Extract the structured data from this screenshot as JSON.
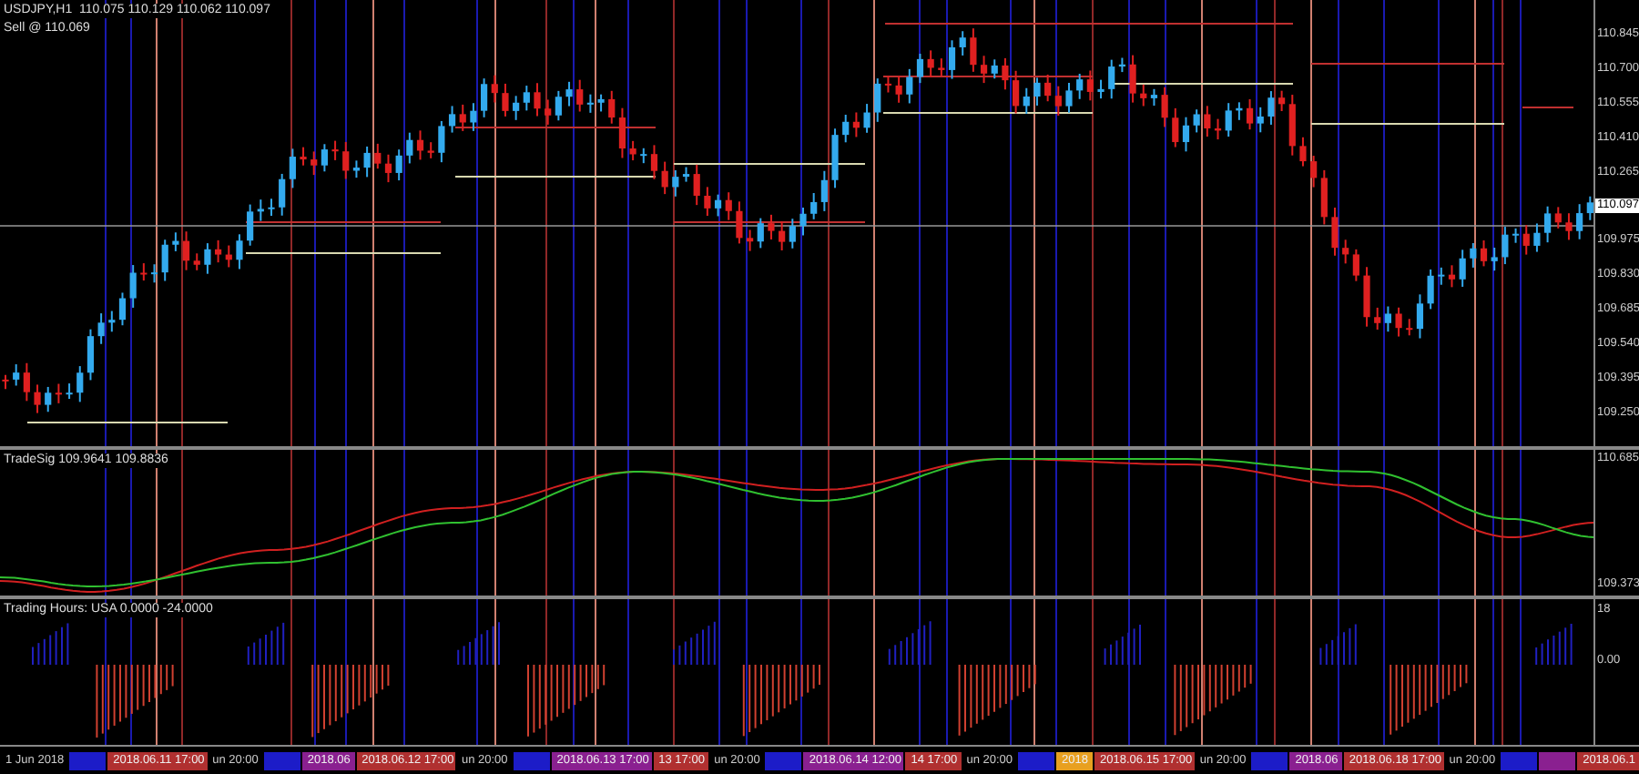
{
  "main_chart": {
    "title": "USDJPY,H1  110.075 110.129 110.062 110.097",
    "order_label": "Sell @ 110.069",
    "price_axis": [
      "110.845",
      "110.700",
      "110.555",
      "110.410",
      "110.265",
      "109.975",
      "109.830",
      "109.685",
      "109.540",
      "109.395",
      "109.250"
    ],
    "current_price": "110.097"
  },
  "trade_sig": {
    "title": "TradeSig 109.9641 109.8836",
    "axis": [
      "110.685",
      "109.373"
    ]
  },
  "trading_hours": {
    "title": "Trading Hours: USA 0.0000 -24.0000",
    "axis": [
      "18",
      "0.00"
    ]
  },
  "time_axis": [
    {
      "kind": "label",
      "text": "1 Jun 2018"
    },
    {
      "kind": "tag",
      "color": "#1c1cc8"
    },
    {
      "kind": "tag",
      "color": "#b03030",
      "text": "2018.06.11 17:00"
    },
    {
      "kind": "label",
      "text": "un 20:00"
    },
    {
      "kind": "tag",
      "color": "#1c1cc8"
    },
    {
      "kind": "tag",
      "color": "#8a2090",
      "text": "2018.06"
    },
    {
      "kind": "tag",
      "color": "#b03030",
      "text": "2018.06.12 17:00"
    },
    {
      "kind": "label",
      "text": "un 20:00"
    },
    {
      "kind": "tag",
      "color": "#1c1cc8"
    },
    {
      "kind": "tag",
      "color": "#8a2090",
      "text": "2018.06.13 17:00"
    },
    {
      "kind": "tag",
      "color": "#b03030",
      "text": "13 17:00"
    },
    {
      "kind": "label",
      "text": "un 20:00"
    },
    {
      "kind": "tag",
      "color": "#1c1cc8"
    },
    {
      "kind": "tag",
      "color": "#8a2090",
      "text": "2018.06.14 12:00"
    },
    {
      "kind": "tag",
      "color": "#b03030",
      "text": "14 17:00"
    },
    {
      "kind": "label",
      "text": "un 20:00"
    },
    {
      "kind": "tag",
      "color": "#1c1cc8"
    },
    {
      "kind": "tag",
      "color": "#e8a020",
      "text": "2018"
    },
    {
      "kind": "tag",
      "color": "#b03030",
      "text": "2018.06.15 17:00"
    },
    {
      "kind": "label",
      "text": "un 20:00"
    },
    {
      "kind": "tag",
      "color": "#1c1cc8"
    },
    {
      "kind": "tag",
      "color": "#8a2090",
      "text": "2018.06"
    },
    {
      "kind": "tag",
      "color": "#b03030",
      "text": "2018.06.18 17:00"
    },
    {
      "kind": "label",
      "text": "un 20:00"
    },
    {
      "kind": "tag",
      "color": "#1c1cc8"
    },
    {
      "kind": "tag",
      "color": "#8a2090"
    },
    {
      "kind": "tag",
      "color": "#b03030",
      "text": "2018.06.1"
    }
  ]
}
